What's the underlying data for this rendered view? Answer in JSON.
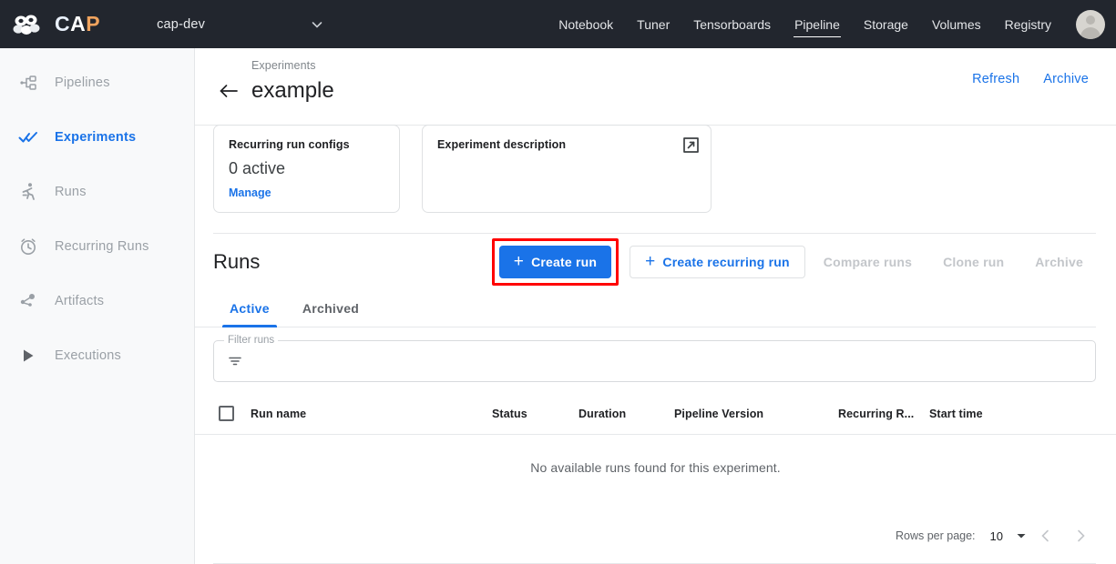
{
  "topbar": {
    "logo": {
      "icon": "cap-people-logo-icon",
      "part1": "C",
      "part2": "A",
      "part3": "P"
    },
    "project": {
      "name": "cap-dev",
      "caret_icon": "chevron-down-icon"
    },
    "nav": [
      {
        "label": "Notebook",
        "active": false
      },
      {
        "label": "Tuner",
        "active": false
      },
      {
        "label": "Tensorboards",
        "active": false
      },
      {
        "label": "Pipeline",
        "active": true
      },
      {
        "label": "Storage",
        "active": false
      },
      {
        "label": "Volumes",
        "active": false
      },
      {
        "label": "Registry",
        "active": false
      }
    ],
    "avatar_icon": "user-avatar-icon"
  },
  "sidebar": {
    "items": [
      {
        "label": "Pipelines",
        "icon": "pipelines-icon",
        "active": false
      },
      {
        "label": "Experiments",
        "icon": "double-check-icon",
        "active": true
      },
      {
        "label": "Runs",
        "icon": "running-person-icon",
        "active": false
      },
      {
        "label": "Recurring Runs",
        "icon": "alarm-clock-icon",
        "active": false
      },
      {
        "label": "Artifacts",
        "icon": "artifacts-dots-icon",
        "active": false
      },
      {
        "label": "Executions",
        "icon": "play-triangle-icon",
        "active": false
      }
    ]
  },
  "page": {
    "breadcrumb": "Experiments",
    "back_icon": "arrow-left-icon",
    "title": "example",
    "actions": [
      {
        "label": "Refresh"
      },
      {
        "label": "Archive"
      }
    ]
  },
  "cards": {
    "recurring": {
      "title": "Recurring run configs",
      "value": "0 active",
      "link": "Manage"
    },
    "description": {
      "title": "Experiment description",
      "expand_icon": "external-link-icon"
    }
  },
  "runs": {
    "title": "Runs",
    "create_run_label": "Create run",
    "create_recurring_label": "Create recurring run",
    "plus_icon": "plus-icon",
    "highlight_color": "#ff0000",
    "primary_color": "#1a73e8",
    "disabled_actions": [
      {
        "label": "Compare runs"
      },
      {
        "label": "Clone run"
      },
      {
        "label": "Archive"
      }
    ],
    "tabs": [
      {
        "label": "Active",
        "active": true
      },
      {
        "label": "Archived",
        "active": false
      }
    ],
    "filter": {
      "legend": "Filter runs",
      "value": "",
      "placeholder": "",
      "icon": "filter-icon"
    },
    "table": {
      "select_all_icon": "checkbox-unchecked-icon",
      "columns": [
        "Run name",
        "Status",
        "Duration",
        "Pipeline Version",
        "Recurring R...",
        "Start time"
      ],
      "rows": [],
      "empty_message": "No available runs found for this experiment."
    },
    "pagination": {
      "rows_per_page_label": "Rows per page:",
      "rows_per_page_value": "10",
      "caret_icon": "caret-down-icon",
      "prev_icon": "chevron-left-icon",
      "next_icon": "chevron-right-icon"
    }
  }
}
